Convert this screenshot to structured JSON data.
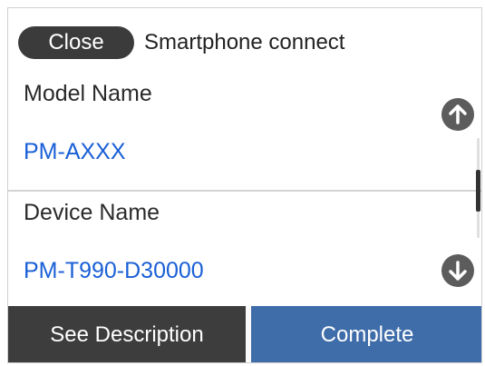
{
  "header": {
    "close_label": "Close",
    "title": "Smartphone connect"
  },
  "items": [
    {
      "label": "Model Name",
      "value": "PM-AXXX"
    },
    {
      "label": "Device Name",
      "value": "PM-T990-D30000"
    }
  ],
  "scroll": {
    "up_icon": "arrow-up-icon",
    "down_icon": "arrow-down-icon"
  },
  "footer": {
    "description_label": "See Description",
    "complete_label": "Complete"
  },
  "colors": {
    "value_text": "#1a5fd6",
    "complete_button": "#3f6daa",
    "description_button": "#3d3d3d"
  }
}
